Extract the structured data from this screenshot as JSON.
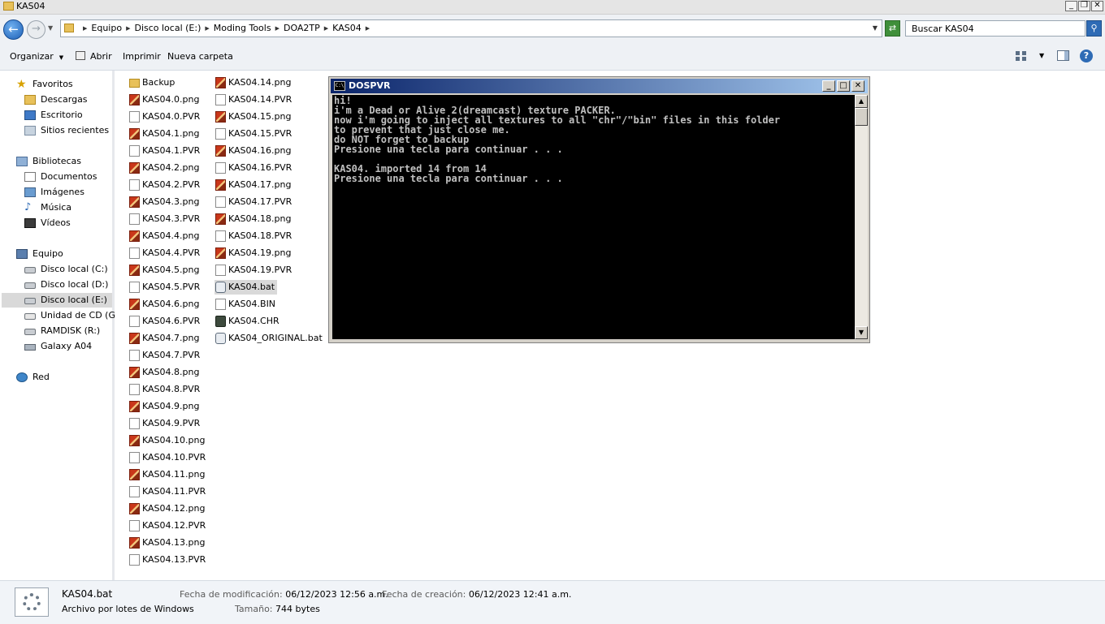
{
  "window": {
    "title": "KAS04"
  },
  "address": {
    "crumbs": [
      "Equipo",
      "Disco local (E:)",
      "Moding Tools",
      "DOA2TP",
      "KAS04"
    ],
    "search_placeholder": "Buscar KAS04"
  },
  "toolbar": {
    "organize": "Organizar",
    "open": "Abrir",
    "print": "Imprimir",
    "new_folder": "Nueva carpeta"
  },
  "sidebar": {
    "favorites": {
      "label": "Favoritos",
      "items": [
        "Descargas",
        "Escritorio",
        "Sitios recientes"
      ]
    },
    "libraries": {
      "label": "Bibliotecas",
      "items": [
        "Documentos",
        "Imágenes",
        "Música",
        "Vídeos"
      ]
    },
    "computer": {
      "label": "Equipo",
      "items": [
        "Disco local (C:)",
        "Disco local (D:)",
        "Disco local (E:)",
        "Unidad de CD (G:)",
        "RAMDISK (R:)",
        "Galaxy A04"
      ]
    },
    "network": {
      "label": "Red"
    }
  },
  "files": {
    "col1": [
      "Backup",
      "KAS04.0.png",
      "KAS04.0.PVR",
      "KAS04.1.png",
      "KAS04.1.PVR",
      "KAS04.2.png",
      "KAS04.2.PVR",
      "KAS04.3.png",
      "KAS04.3.PVR",
      "KAS04.4.png",
      "KAS04.4.PVR",
      "KAS04.5.png",
      "KAS04.5.PVR",
      "KAS04.6.png",
      "KAS04.6.PVR",
      "KAS04.7.png",
      "KAS04.7.PVR",
      "KAS04.8.png",
      "KAS04.8.PVR",
      "KAS04.9.png",
      "KAS04.9.PVR",
      "KAS04.10.png",
      "KAS04.10.PVR",
      "KAS04.11.png",
      "KAS04.11.PVR",
      "KAS04.12.png",
      "KAS04.12.PVR",
      "KAS04.13.png",
      "KAS04.13.PVR"
    ],
    "col2": [
      "KAS04.14.png",
      "KAS04.14.PVR",
      "KAS04.15.png",
      "KAS04.15.PVR",
      "KAS04.16.png",
      "KAS04.16.PVR",
      "KAS04.17.png",
      "KAS04.17.PVR",
      "KAS04.18.png",
      "KAS04.18.PVR",
      "KAS04.19.png",
      "KAS04.19.PVR",
      "KAS04.bat",
      "KAS04.BIN",
      "KAS04.CHR",
      "KAS04_ORIGINAL.bat"
    ]
  },
  "console": {
    "title": "DOSPVR",
    "icon_text": "C:\\",
    "lines": [
      "hi!",
      "i'm a Dead or Alive 2(dreamcast) texture PACKER.",
      "now i'm going to inject all textures to all \"chr\"/\"bin\" files in this folder",
      "to prevent that just close me.",
      "do NOT forget to backup",
      "Presione una tecla para continuar . . .",
      "",
      "KAS04. imported 14 from 14",
      "Presione una tecla para continuar . . ."
    ]
  },
  "details": {
    "name": "KAS04.bat",
    "type": "Archivo por lotes de Windows",
    "modified_label": "Fecha de modificación:",
    "modified_value": "06/12/2023 12:56 a.m.",
    "created_label": "Fecha de creación:",
    "created_value": "06/12/2023 12:41 a.m.",
    "size_label": "Tamaño:",
    "size_value": "744 bytes"
  }
}
